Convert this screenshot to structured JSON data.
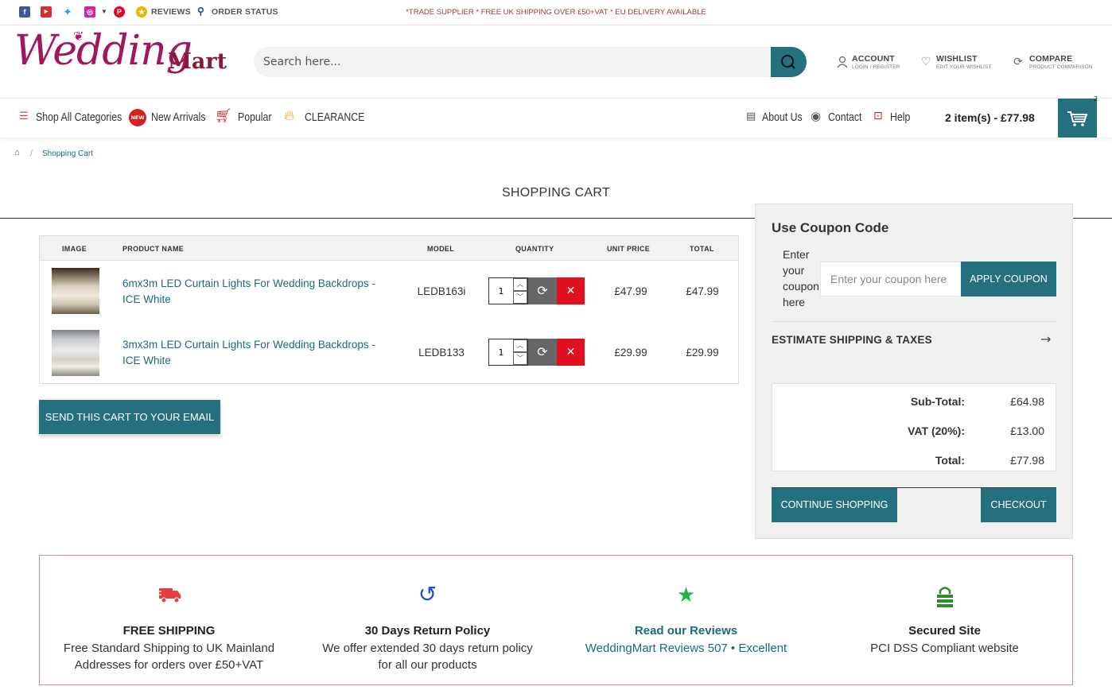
{
  "topbar": {
    "reviews": "REVIEWS",
    "order_status": "ORDER STATUS",
    "promo": "*TRADE SUPPLIER * FREE UK SHIPPING OVER £50+VAT * EU DELIVERY AVAILABLE"
  },
  "header": {
    "logo_script": "Wedding",
    "logo_brand": "Mart",
    "search_placeholder": "Search here...",
    "account": "ACCOUNT",
    "account_sub": "LOGIN / REGISTER",
    "wishlist": "WISHLIST",
    "wishlist_sub": "EDIT YOUR WISHLIST",
    "compare": "COMPARE",
    "compare_sub": "PRODUCT COMPARISON"
  },
  "nav": {
    "shop_all": "Shop All Categories",
    "new_badge": "NEW",
    "new_arrivals": "New Arrivals",
    "popular": "Popular",
    "clearance": "CLEARANCE",
    "about": "About Us",
    "contact": "Contact",
    "help": "Help",
    "cart_total": "2 item(s) - £77.98",
    "cart_count": "2"
  },
  "breadcrumb": {
    "current": "Shopping Cart"
  },
  "page_title": "SHOPPING CART",
  "table": {
    "headers": {
      "image": "IMAGE",
      "name": "PRODUCT NAME",
      "model": "MODEL",
      "quantity": "QUANTITY",
      "unit_price": "UNIT PRICE",
      "total": "TOTAL"
    },
    "rows": [
      {
        "name": "6mx3m LED Curtain Lights For Wedding Backdrops - ICE White",
        "model": "LEDB163i",
        "qty": "1",
        "unit_price": "£47.99",
        "total": "£47.99"
      },
      {
        "name": "3mx3m LED Curtain Lights For Wedding Backdrops - ICE White",
        "model": "LEDB133",
        "qty": "1",
        "unit_price": "£29.99",
        "total": "£29.99"
      }
    ]
  },
  "send_email": "SEND THIS CART TO YOUR EMAIL",
  "side": {
    "coupon_heading": "Use Coupon Code",
    "coupon_label": "Enter your coupon here",
    "coupon_placeholder": "Enter your coupon here",
    "apply": "APPLY COUPON",
    "estimate": "ESTIMATE SHIPPING & TAXES",
    "subtotal_label": "Sub-Total:",
    "subtotal": "£64.98",
    "vat_label": "VAT (20%):",
    "vat": "£13.00",
    "total_label": "Total:",
    "total": "£77.98",
    "continue": "CONTINUE SHOPPING",
    "checkout": "CHECKOUT"
  },
  "features": [
    {
      "title": "FREE SHIPPING",
      "desc": "Free Standard Shipping to UK Mainland Addresses for orders over £50+VAT"
    },
    {
      "title": "30 Days Return Policy",
      "desc": "We offer extended 30 days return policy for all our products"
    },
    {
      "title": "Read our Reviews",
      "desc": "WeddingMart Reviews 507 • Excellent"
    },
    {
      "title": "Secured Site",
      "desc": "PCI DSS Compliant website"
    }
  ],
  "colors": {
    "teal": "#25707f",
    "red": "#e0101e",
    "brand": "#a0175e"
  }
}
